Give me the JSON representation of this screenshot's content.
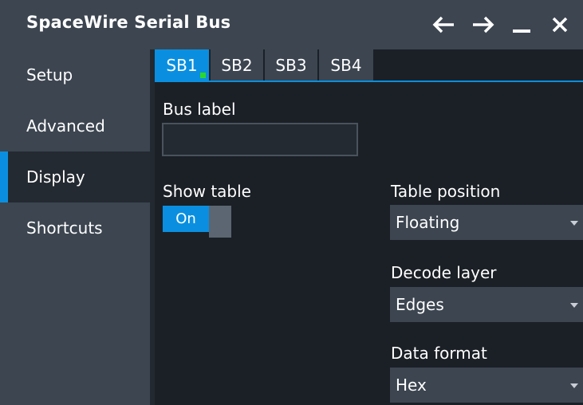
{
  "window": {
    "title": "SpaceWire Serial Bus"
  },
  "sidebar": {
    "items": [
      {
        "label": "Setup"
      },
      {
        "label": "Advanced"
      },
      {
        "label": "Display",
        "active": true
      },
      {
        "label": "Shortcuts"
      }
    ]
  },
  "tabs": [
    {
      "label": "SB1",
      "active": true
    },
    {
      "label": "SB2"
    },
    {
      "label": "SB3"
    },
    {
      "label": "SB4"
    }
  ],
  "form": {
    "bus_label": {
      "label": "Bus label",
      "value": ""
    },
    "show_table": {
      "label": "Show table",
      "state": "On"
    },
    "table_position": {
      "label": "Table position",
      "value": "Floating"
    },
    "decode_layer": {
      "label": "Decode layer",
      "value": "Edges"
    },
    "data_format": {
      "label": "Data format",
      "value": "Hex"
    }
  },
  "icons": [
    "back-arrow-icon",
    "forward-arrow-icon",
    "minimize-icon",
    "close-icon",
    "chevron-down-icon"
  ],
  "colors": {
    "accent": "#0a8fe0",
    "panel": "#3c4550",
    "background": "#1b2026",
    "active_indicator": "#29d82a"
  }
}
